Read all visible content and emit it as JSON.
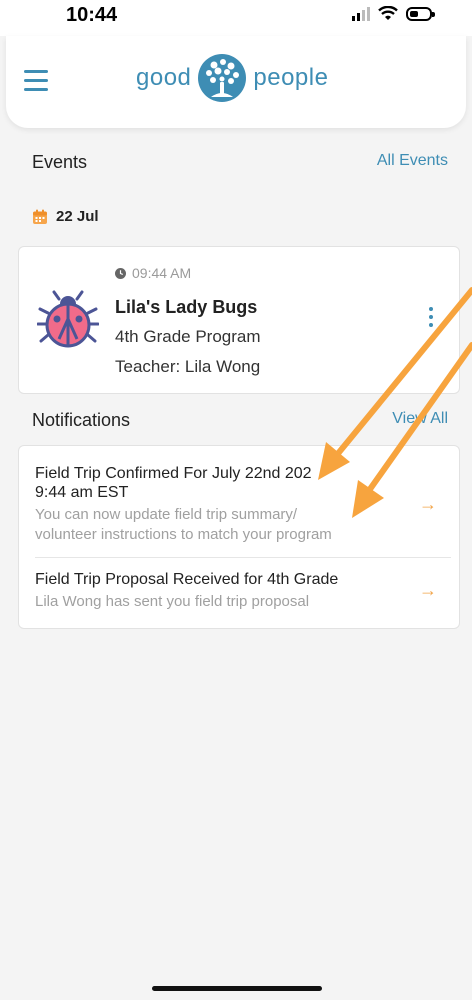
{
  "status_bar": {
    "time": "10:44"
  },
  "header": {
    "logo_left": "good",
    "logo_right": "people",
    "brand_color": "#3e8db4"
  },
  "events": {
    "section_title": "Events",
    "all_link": "All Events",
    "date": "22 Jul",
    "card": {
      "time": "09:44 AM",
      "title": "Lila's Lady Bugs",
      "program": "4th Grade Program",
      "teacher": "Teacher: Lila Wong"
    }
  },
  "notifications": {
    "section_title": "Notifications",
    "view_all": "View All",
    "items": [
      {
        "title_line1": "Field Trip Confirmed For July 22nd 202",
        "title_line2": "9:44 am EST",
        "desc_line1": "You can now update field trip summary/",
        "desc_line2": "volunteer instructions to match your program"
      },
      {
        "title_line1": "Field Trip Proposal Received for 4th Grade",
        "desc_line1": "Lila Wong has sent you field trip proposal"
      }
    ],
    "arrow_color": "#f2a54a"
  },
  "icons": [
    "menu-icon",
    "logo-tree-icon",
    "calendar-icon",
    "clock-icon",
    "ladybug-icon",
    "kebab-icon",
    "arrow-right-icon",
    "signal-icon",
    "wifi-icon",
    "battery-icon"
  ]
}
